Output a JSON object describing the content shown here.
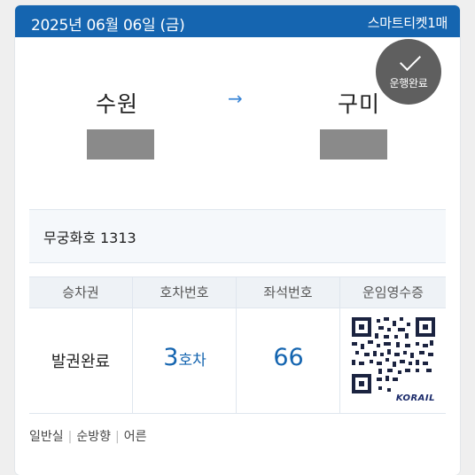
{
  "header": {
    "date": "2025년 06월 06일 (금)",
    "ticket_type": "스마트티켓1매"
  },
  "status": {
    "label": "운행완료",
    "icon": "check-icon"
  },
  "route": {
    "departure": "수원",
    "arrival": "구미",
    "arrow": "→"
  },
  "train": {
    "label": "무궁화호 1313"
  },
  "table": {
    "headers": [
      "승차권",
      "호차번호",
      "좌석번호",
      "운임영수증"
    ],
    "issue_status": "발권완료",
    "car_number": "3",
    "car_unit": "호차",
    "seat_number": "66",
    "receipt_brand": "KORAIL"
  },
  "footer": {
    "items": [
      "일반실",
      "순방향",
      "어른"
    ]
  },
  "colors": {
    "header_bg": "#1565b0",
    "accent": "#1565b0",
    "status_bg": "#5f5f5f"
  }
}
